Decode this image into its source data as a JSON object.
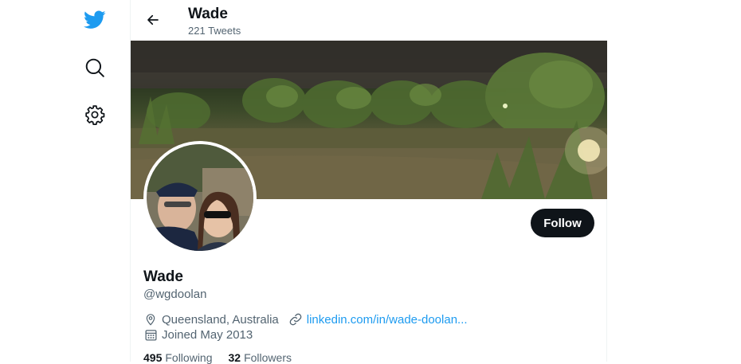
{
  "nav": {
    "icons": [
      "twitter-bird-icon",
      "search-icon",
      "gear-icon"
    ]
  },
  "header": {
    "title": "Wade",
    "tweet_count": "221 Tweets"
  },
  "profile": {
    "name": "Wade",
    "handle": "@wgdoolan",
    "follow_label": "Follow",
    "location": "Queensland, Australia",
    "website": "linkedin.com/in/wade-doolan...",
    "joined": "Joined May 2013",
    "following_count": "495",
    "following_label": "Following",
    "followers_count": "32",
    "followers_label": "Followers"
  },
  "colors": {
    "brand": "#1d9bf0",
    "text_primary": "#0f1419",
    "text_secondary": "#536471",
    "button": "#0f1419"
  }
}
